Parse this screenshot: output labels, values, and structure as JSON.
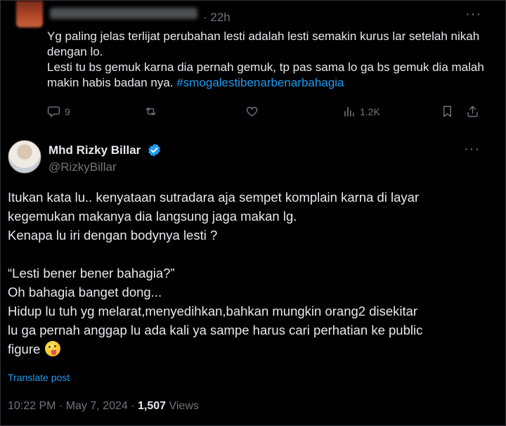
{
  "reply": {
    "time": "· 22h",
    "more": "···",
    "body_text": "Yg paling jelas terlijat perubahan lesti adalah lesti semakin kurus lar setelah nikah dengan lo.\nLesti tu bs gemuk karna dia pernah gemuk, tp pas sama lo ga bs gemuk dia malah makin habis badan nya. ",
    "hashtag": "#smogalestibenarbenarbahagia",
    "actions": {
      "replies": "9",
      "reposts": "",
      "likes": "",
      "views": "1.2K"
    }
  },
  "tweet": {
    "name": "Mhd Rizky Billar",
    "handle": "@RizkyBillar",
    "more": "···",
    "paragraph1": [
      "Itukan kata lu.. kenyataan sutradara aja sempet komplain karna di layar",
      "kegemukan makanya dia langsung jaga makan lg.",
      "Kenapa lu iri dengan bodynya lesti ?"
    ],
    "paragraph2": [
      "“Lesti bener bener bahagia?”",
      "Oh bahagia banget dong...",
      "Hidup lu tuh yg melarat,menyedihkan,bahkan mungkin orang2 disekitar",
      "lu ga pernah anggap lu ada kali ya sampe harus cari perhatian ke public",
      "figure "
    ],
    "translate": "Translate post",
    "timestamp": "10:22 PM · May 7, 2024 · ",
    "views_count": "1,507",
    "views_label": " Views"
  },
  "colors": {
    "background": "#000000",
    "text": "#e7e9ea",
    "muted": "#71767b",
    "accent": "#1d9bf0"
  },
  "icons": [
    "comment-icon",
    "repost-icon",
    "like-icon",
    "views-icon",
    "bookmark-icon",
    "share-icon",
    "verified-icon",
    "tongue-emoji"
  ]
}
